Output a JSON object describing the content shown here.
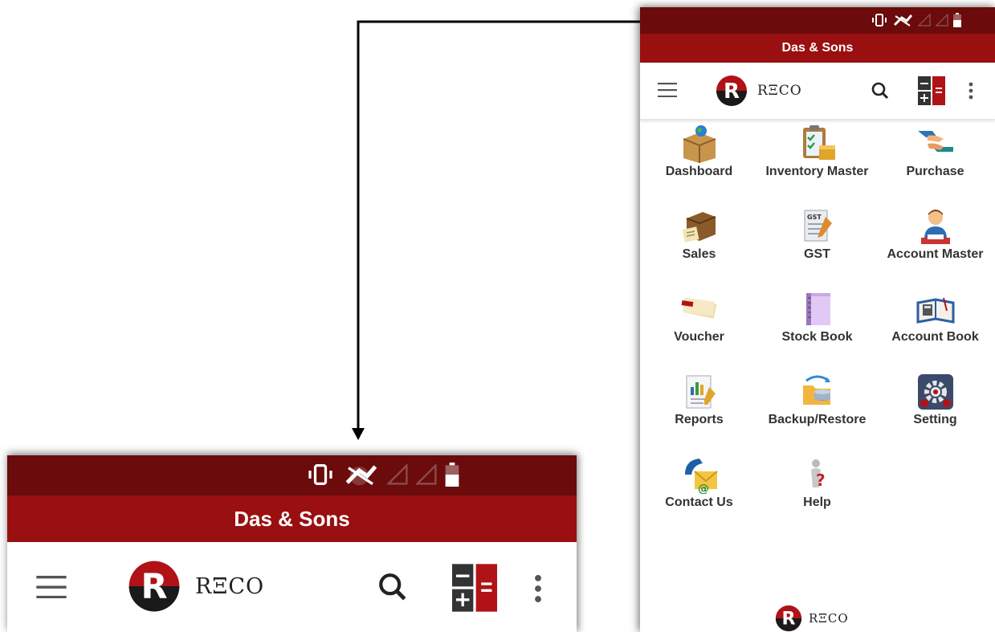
{
  "app": {
    "company_name": "Das & Sons",
    "logo_text": "RΞCO"
  },
  "colors": {
    "status_bar": "#6b0b0b",
    "title_bar": "#9a0f10",
    "accent": "#b01217"
  },
  "toolbar": {
    "menu_icon": "hamburger-icon",
    "search_icon": "search-icon",
    "calculator_icon": "calculator-icon",
    "overflow_icon": "more-vert-icon"
  },
  "menu": {
    "items": [
      {
        "label": "Dashboard",
        "icon": "dashboard-box-icon"
      },
      {
        "label": "Inventory Master",
        "icon": "inventory-clipboard-icon"
      },
      {
        "label": "Purchase",
        "icon": "purchase-handshake-icon"
      },
      {
        "label": "Sales",
        "icon": "sales-box-icon"
      },
      {
        "label": "GST",
        "icon": "gst-document-icon"
      },
      {
        "label": "Account Master",
        "icon": "account-person-icon"
      },
      {
        "label": "Voucher",
        "icon": "voucher-cheque-icon"
      },
      {
        "label": "Stock Book",
        "icon": "stock-book-icon"
      },
      {
        "label": "Account Book",
        "icon": "account-book-icon"
      },
      {
        "label": "Reports",
        "icon": "reports-chart-icon"
      },
      {
        "label": "Backup/Restore",
        "icon": "backup-restore-icon"
      },
      {
        "label": "Setting",
        "icon": "settings-gear-icon"
      },
      {
        "label": "Contact Us",
        "icon": "contact-phone-icon"
      },
      {
        "label": "Help",
        "icon": "help-figure-icon"
      }
    ]
  }
}
